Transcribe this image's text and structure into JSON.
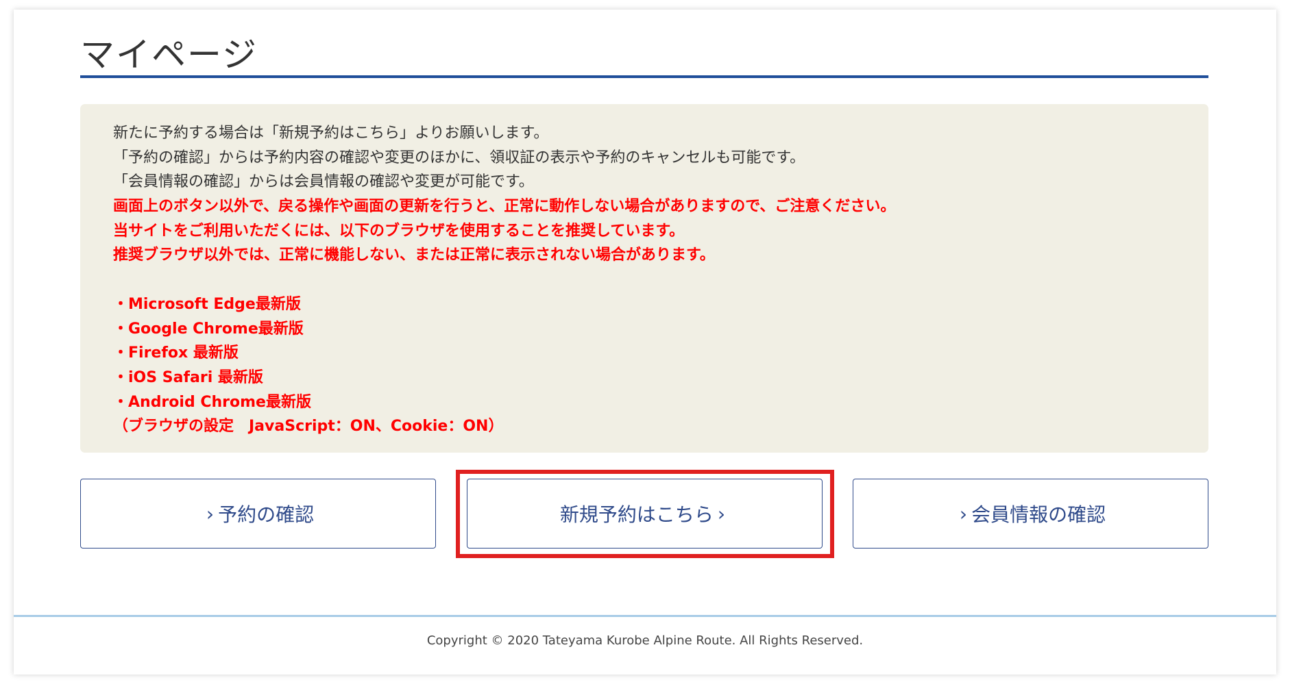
{
  "page": {
    "title": "マイページ",
    "accent_color": "#1f4e9a",
    "warning_color": "#ff0000",
    "highlight_color": "#e02020"
  },
  "notice": {
    "lines": [
      {
        "style": "normal",
        "text": "新たに予約する場合は「新規予約はこちら」よりお願いします。"
      },
      {
        "style": "normal",
        "text": "「予約の確認」からは予約内容の確認や変更のほかに、領収証の表示や予約のキャンセルも可能です。"
      },
      {
        "style": "normal",
        "text": "「会員情報の確認」からは会員情報の確認や変更が可能です。"
      },
      {
        "style": "warn",
        "text": "画面上のボタン以外で、戻る操作や画面の更新を行うと、正常に動作しない場合がありますので、ご注意ください。"
      },
      {
        "style": "warn",
        "text": "当サイトをご利用いただくには、以下のブラウザを使用することを推奨しています。"
      },
      {
        "style": "warn",
        "text": "推奨ブラウザ以外では、正常に機能しない、または正常に表示されない場合があります。"
      },
      {
        "style": "blank",
        "text": ""
      },
      {
        "style": "warn",
        "text": "・Microsoft Edge最新版"
      },
      {
        "style": "warn",
        "text": "・Google Chrome最新版"
      },
      {
        "style": "warn",
        "text": "・Firefox 最新版"
      },
      {
        "style": "warn",
        "text": "・iOS Safari 最新版"
      },
      {
        "style": "warn",
        "text": "・Android Chrome最新版"
      },
      {
        "style": "warn",
        "text": "（ブラウザの設定　JavaScript：ON、Cookie：ON）"
      }
    ]
  },
  "buttons": {
    "check_reservation": {
      "chevron": "›",
      "label": "予約の確認"
    },
    "new_reservation": {
      "chevron": "›",
      "label": "新規予約はこちら"
    },
    "member_info": {
      "chevron": "›",
      "label": "会員情報の確認"
    }
  },
  "footer": {
    "copyright": "Copyright © 2020 Tateyama Kurobe Alpine Route. All Rights Reserved."
  }
}
